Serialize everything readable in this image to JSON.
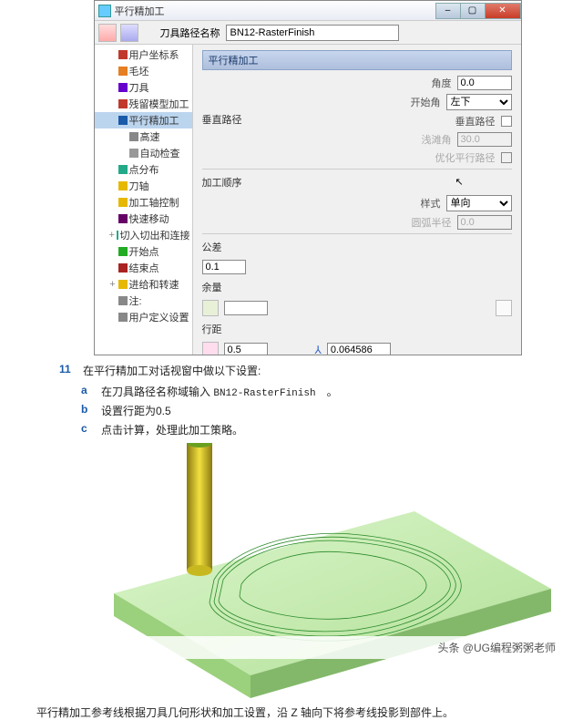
{
  "window": {
    "title": "平行精加工",
    "min": "–",
    "max": "▢",
    "close": "✕"
  },
  "toolpath_name_label": "刀具路径名称",
  "toolpath_name": "BN12-RasterFinish",
  "tree": {
    "items": [
      {
        "label": "用户坐标系",
        "icon": "#c0392b"
      },
      {
        "label": "毛坯",
        "icon": "#e67e22"
      },
      {
        "label": "刀具",
        "icon": "#60c"
      },
      {
        "label": "残留模型加工",
        "icon": "#c0392b"
      },
      {
        "label": "平行精加工",
        "icon": "#1a5aa8",
        "sel": true
      },
      {
        "label": "高速",
        "icon": "#888",
        "indent": 2
      },
      {
        "label": "自动检查",
        "icon": "#999",
        "indent": 2
      },
      {
        "label": "点分布",
        "icon": "#2a8"
      },
      {
        "label": "刀轴",
        "icon": "#e6b800"
      },
      {
        "label": "加工轴控制",
        "icon": "#e6b800"
      },
      {
        "label": "快速移动",
        "icon": "#606"
      },
      {
        "label": "切入切出和连接",
        "icon": "#2a8",
        "expand": "+"
      },
      {
        "label": "开始点",
        "icon": "#2a2"
      },
      {
        "label": "结束点",
        "icon": "#a22"
      },
      {
        "label": "进给和转速",
        "icon": "#e6b800",
        "expand": "+"
      },
      {
        "label": "注:",
        "icon": "#888"
      },
      {
        "label": "用户定义设置",
        "icon": "#888"
      }
    ]
  },
  "panel": {
    "header": "平行精加工",
    "angle_label": "角度",
    "angle_value": "0.0",
    "start_corner_label": "开始角",
    "start_corner_value": "左下",
    "vpath_group": "垂直路径",
    "vpath_label": "垂直路径",
    "shallow_label": "浅滩角",
    "shallow_value": "30.0",
    "opt_label": "优化平行路径",
    "order_group": "加工顺序",
    "style_label": "样式",
    "style_value": "单向",
    "arc_label": "圆弧半径",
    "arc_value": "0.0",
    "tol_label": "公差",
    "tol_value": "0.1",
    "stock_label": "余量",
    "stepover_label": "行距",
    "stepover_value": "0.5",
    "scallop_value": "0.064586"
  },
  "steps": {
    "num": "11",
    "title": "在平行精加工对话视窗中做以下设置:",
    "a": "在刀具路径名称域输入",
    "a_val": "BN12-RasterFinish",
    "a_end": "。",
    "b": "设置行距为0.5",
    "c": "点击计算，处理此加工策略。"
  },
  "attribution": "头条 @UG编程粥粥老师",
  "bottom": "平行精加工参考线根据刀具几何形状和加工设置，沿 Z 轴向下将参考线投影到部件上。"
}
